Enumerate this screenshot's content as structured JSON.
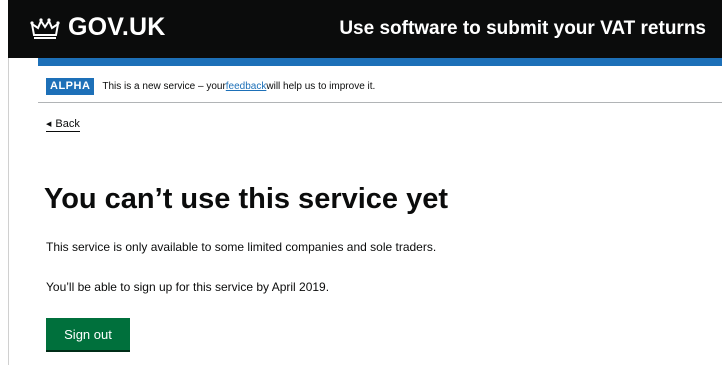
{
  "header": {
    "logo_text": "GOV.UK",
    "service_name": "Use software to submit your VAT returns",
    "background_color": "#0b0c0c",
    "accent_color": "#1d70b8"
  },
  "phase_banner": {
    "tag": "ALPHA",
    "text_before": "This is a new service – your ",
    "link_text": "feedback",
    "text_after": " will help us to improve it."
  },
  "back_link": {
    "arrow": "◀",
    "label": "Back"
  },
  "main": {
    "heading": "You can’t use this service yet",
    "paragraph_1": "This service is only available to some limited companies and sole traders.",
    "paragraph_2": "You’ll be able to sign up for this service by April 2019.",
    "sign_out_label": "Sign out",
    "button_color": "#00703c"
  },
  "icons": {
    "logo": "crown-icon",
    "back": "back-arrow-icon"
  }
}
